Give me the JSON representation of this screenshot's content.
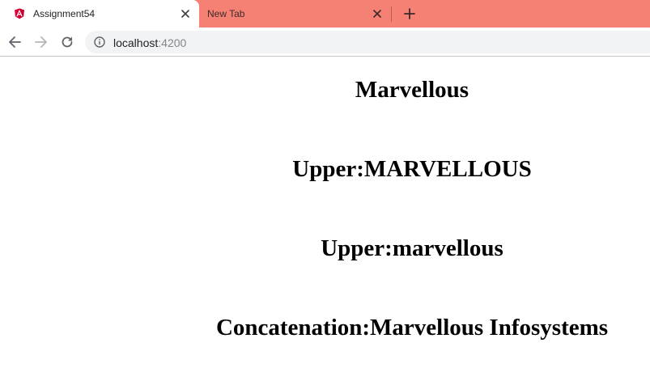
{
  "browser": {
    "tabs": [
      {
        "title": "Assignment54",
        "active": true,
        "favicon": "angular-icon"
      },
      {
        "title": "New Tab",
        "active": false
      }
    ],
    "address_bar": {
      "host": "localhost",
      "port": ":4200"
    },
    "colors": {
      "tabstrip": "#f58174",
      "angular_red": "#dd0031"
    }
  },
  "page": {
    "headings": [
      "Marvellous",
      "Upper:MARVELLOUS",
      "Upper:marvellous",
      "Concatenation:Marvellous Infosystems"
    ]
  }
}
